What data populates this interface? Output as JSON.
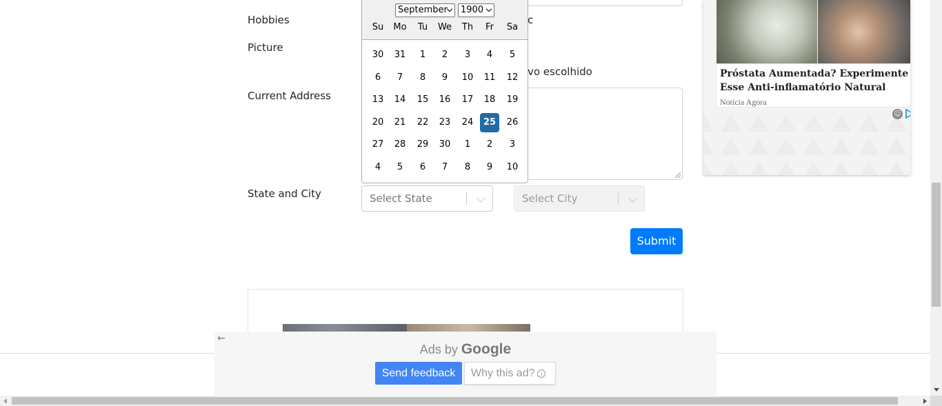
{
  "form": {
    "hobbies_label": "Hobbies",
    "hobbies_partial": "c",
    "picture_label": "Picture",
    "picture_status_partial": "vo escolhido",
    "address_label": "Current Address",
    "state_city_label": "State and City",
    "state_placeholder": "Select State",
    "city_placeholder": "Select City",
    "submit_label": "Submit"
  },
  "datepicker": {
    "month": "September",
    "year": "1900",
    "day_names": [
      "Su",
      "Mo",
      "Tu",
      "We",
      "Th",
      "Fr",
      "Sa"
    ],
    "weeks": [
      [
        "30",
        "31",
        "1",
        "2",
        "3",
        "4",
        "5"
      ],
      [
        "6",
        "7",
        "8",
        "9",
        "10",
        "11",
        "12"
      ],
      [
        "13",
        "14",
        "15",
        "16",
        "17",
        "18",
        "19"
      ],
      [
        "20",
        "21",
        "22",
        "23",
        "24",
        "25",
        "26"
      ],
      [
        "27",
        "28",
        "29",
        "30",
        "1",
        "2",
        "3"
      ],
      [
        "4",
        "5",
        "6",
        "7",
        "8",
        "9",
        "10"
      ]
    ],
    "selected_day": "25"
  },
  "right_ad": {
    "title": "Próstata Aumentada? Experimente Esse Anti-inflamatório Natural",
    "source": "Notícia Agora"
  },
  "google_ads": {
    "ads_by": "Ads by",
    "brand": "Google",
    "feedback_label": "Send feedback",
    "why_label": "Why this ad?"
  },
  "colors": {
    "primary": "#007bff",
    "datepicker_selected": "#216ba5",
    "feedback_button": "#4285f4"
  }
}
